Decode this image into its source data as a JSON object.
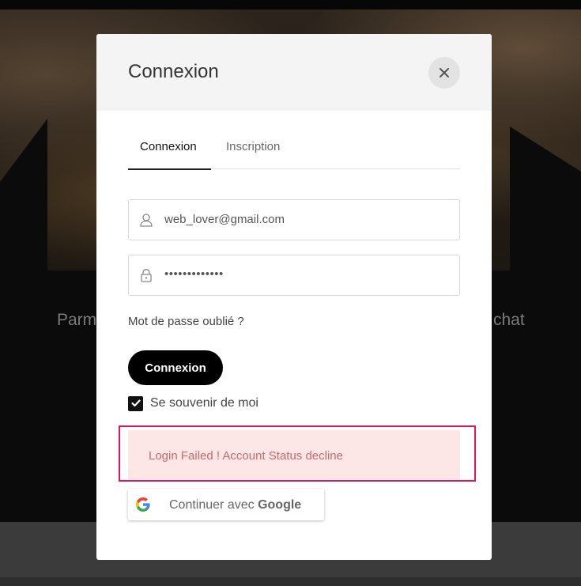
{
  "background": {
    "left_text": "Parm",
    "right_text": "chat"
  },
  "modal": {
    "title": "Connexion",
    "close_icon": "close-icon",
    "tabs": [
      {
        "label": "Connexion",
        "active": true
      },
      {
        "label": "Inscription",
        "active": false
      }
    ],
    "email": {
      "value": "web_lover@gmail.com",
      "icon": "user-icon"
    },
    "password": {
      "value": "•••••••••••••",
      "icon": "lock-icon"
    },
    "forgot_label": "Mot de passe oublié ?",
    "login_label": "Connexion",
    "remember": {
      "label": "Se souvenir de moi",
      "checked": true
    },
    "error": {
      "message": "Login Failed ! Account Status decline"
    },
    "google": {
      "prefix": "Continuer avec",
      "brand": "Google"
    }
  },
  "colors": {
    "error_outline": "#e4145a",
    "error_bg": "#fde6e6",
    "error_text": "#c96a6a",
    "primary_button": "#000000"
  }
}
